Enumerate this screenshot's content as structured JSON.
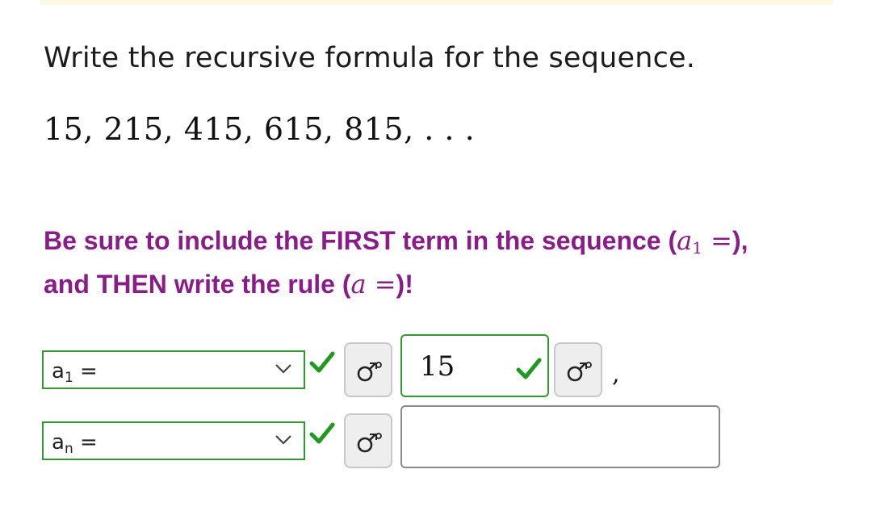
{
  "question": {
    "prompt": "Write the recursive formula for the sequence.",
    "sequence": "15, 215, 415, 615, 815, . . ."
  },
  "instructions": {
    "line1_prefix": "Be sure to include the FIRST term in the sequence (",
    "line1_math_var": "a",
    "line1_math_sub": "1",
    "line1_math_eq": " =",
    "line1_suffix": "),",
    "line2_prefix": "and THEN write the rule (",
    "line2_math_var": "a",
    "line2_math_eq": "  =",
    "line2_suffix": ")!"
  },
  "row1": {
    "select_var": "a",
    "select_sub": "1",
    "select_eq": "=",
    "answer_value": "15",
    "separator": ","
  },
  "row2": {
    "select_var": "a",
    "select_sub": "n",
    "select_eq": "=",
    "answer_value": ""
  },
  "colors": {
    "instruction_text": "#8a1c8a",
    "correct_border": "#2f9a2f",
    "correct_check": "#1f9a1f"
  },
  "icons": {
    "keyboard_button": "math-keyboard-icon",
    "dropdown": "chevron-down-icon",
    "status": "checkmark-icon"
  }
}
